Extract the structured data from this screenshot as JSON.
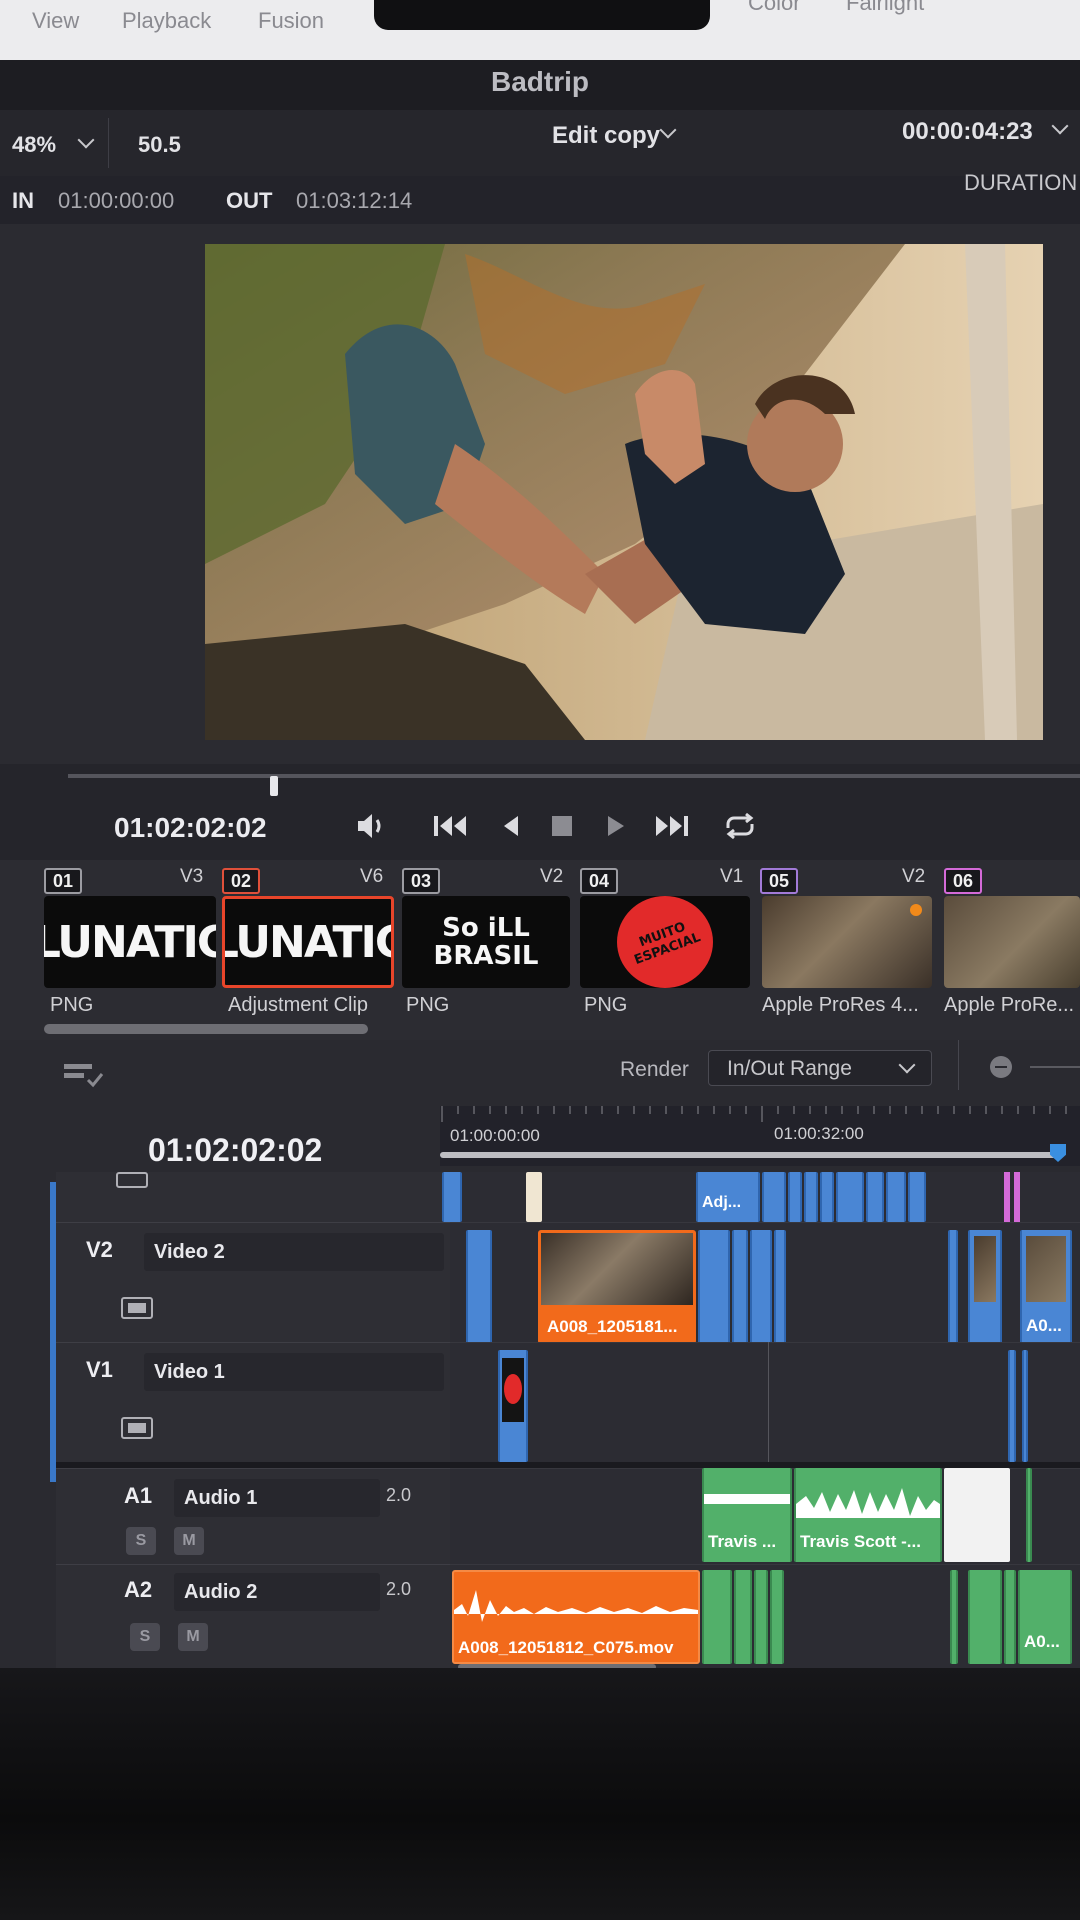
{
  "menu": [
    "View",
    "Playback",
    "Fusion",
    "Color",
    "Fairlight"
  ],
  "window_title": "Badtrip",
  "viewer": {
    "zoom": "48%",
    "zoom_value": "50.5",
    "timeline_name": "Edit copy",
    "duration_tc": "00:00:04:23",
    "duration_label": "DURATION",
    "in_label": "IN",
    "in_tc": "01:00:00:00",
    "out_label": "OUT",
    "out_tc": "01:03:12:14",
    "scrub_position": 0.2
  },
  "transport": {
    "timecode": "01:02:02:02",
    "buttons": [
      "volume-icon",
      "skip-to-start-icon",
      "reverse-play-icon",
      "stop-icon",
      "play-icon",
      "skip-to-end-icon",
      "loop-icon"
    ]
  },
  "clips": [
    {
      "num": "01",
      "track": "V3",
      "label": "PNG",
      "thumb": "LUNATIC",
      "num_color": "#9c9ca2"
    },
    {
      "num": "02",
      "track": "V6",
      "label": "Adjustment Clip",
      "thumb": "LUNATIC",
      "num_color": "#e0503a",
      "selected": true
    },
    {
      "num": "03",
      "track": "V2",
      "label": "PNG",
      "thumb": "So iLL BRASIL",
      "num_color": "#9c9ca2"
    },
    {
      "num": "04",
      "track": "V1",
      "label": "PNG",
      "thumb": "MUITO ESPACIAL",
      "num_color": "#9c9ca2"
    },
    {
      "num": "05",
      "track": "V2",
      "label": "Apple ProRes 4...",
      "thumb": "video",
      "num_color": "#a27ad8"
    },
    {
      "num": "06",
      "track": "",
      "label": "Apple ProRe...",
      "thumb": "video",
      "num_color": "#d46ad8"
    }
  ],
  "render": {
    "label": "Render",
    "value": "In/Out Range"
  },
  "timeline": {
    "timecode": "01:02:02:02",
    "ruler_start": "01:00:00:00",
    "ruler_mid": "01:00:32:00",
    "tracks": [
      {
        "id": "V2",
        "name": "Video 2"
      },
      {
        "id": "V1",
        "name": "Video 1"
      },
      {
        "id": "A1",
        "name": "Audio 1",
        "channels": "2.0"
      },
      {
        "id": "A2",
        "name": "Audio 2",
        "channels": "2.0"
      }
    ],
    "solo_label": "S",
    "mute_label": "M",
    "clip_adj": "Adj...",
    "clip_v2": "A008_1205181...",
    "clip_v2_end": "A0...",
    "clip_a1_1": "Travis ...",
    "clip_a1_2": "Travis Scott -...",
    "clip_a2_main": "A008_12051812_C075.mov",
    "clip_a2_end": "A0..."
  },
  "bottom_nav": [
    "media-page-icon",
    "cut-page-icon",
    "edit-page-icon",
    "fusion-page-icon",
    "fairlight-page-icon",
    "deliver-page-icon"
  ],
  "colors": {
    "selected_orange": "#f26a1b",
    "clip_blue": "#4a86d4",
    "audio_green": "#52b06a",
    "playhead_blue": "#3a8fe0"
  }
}
